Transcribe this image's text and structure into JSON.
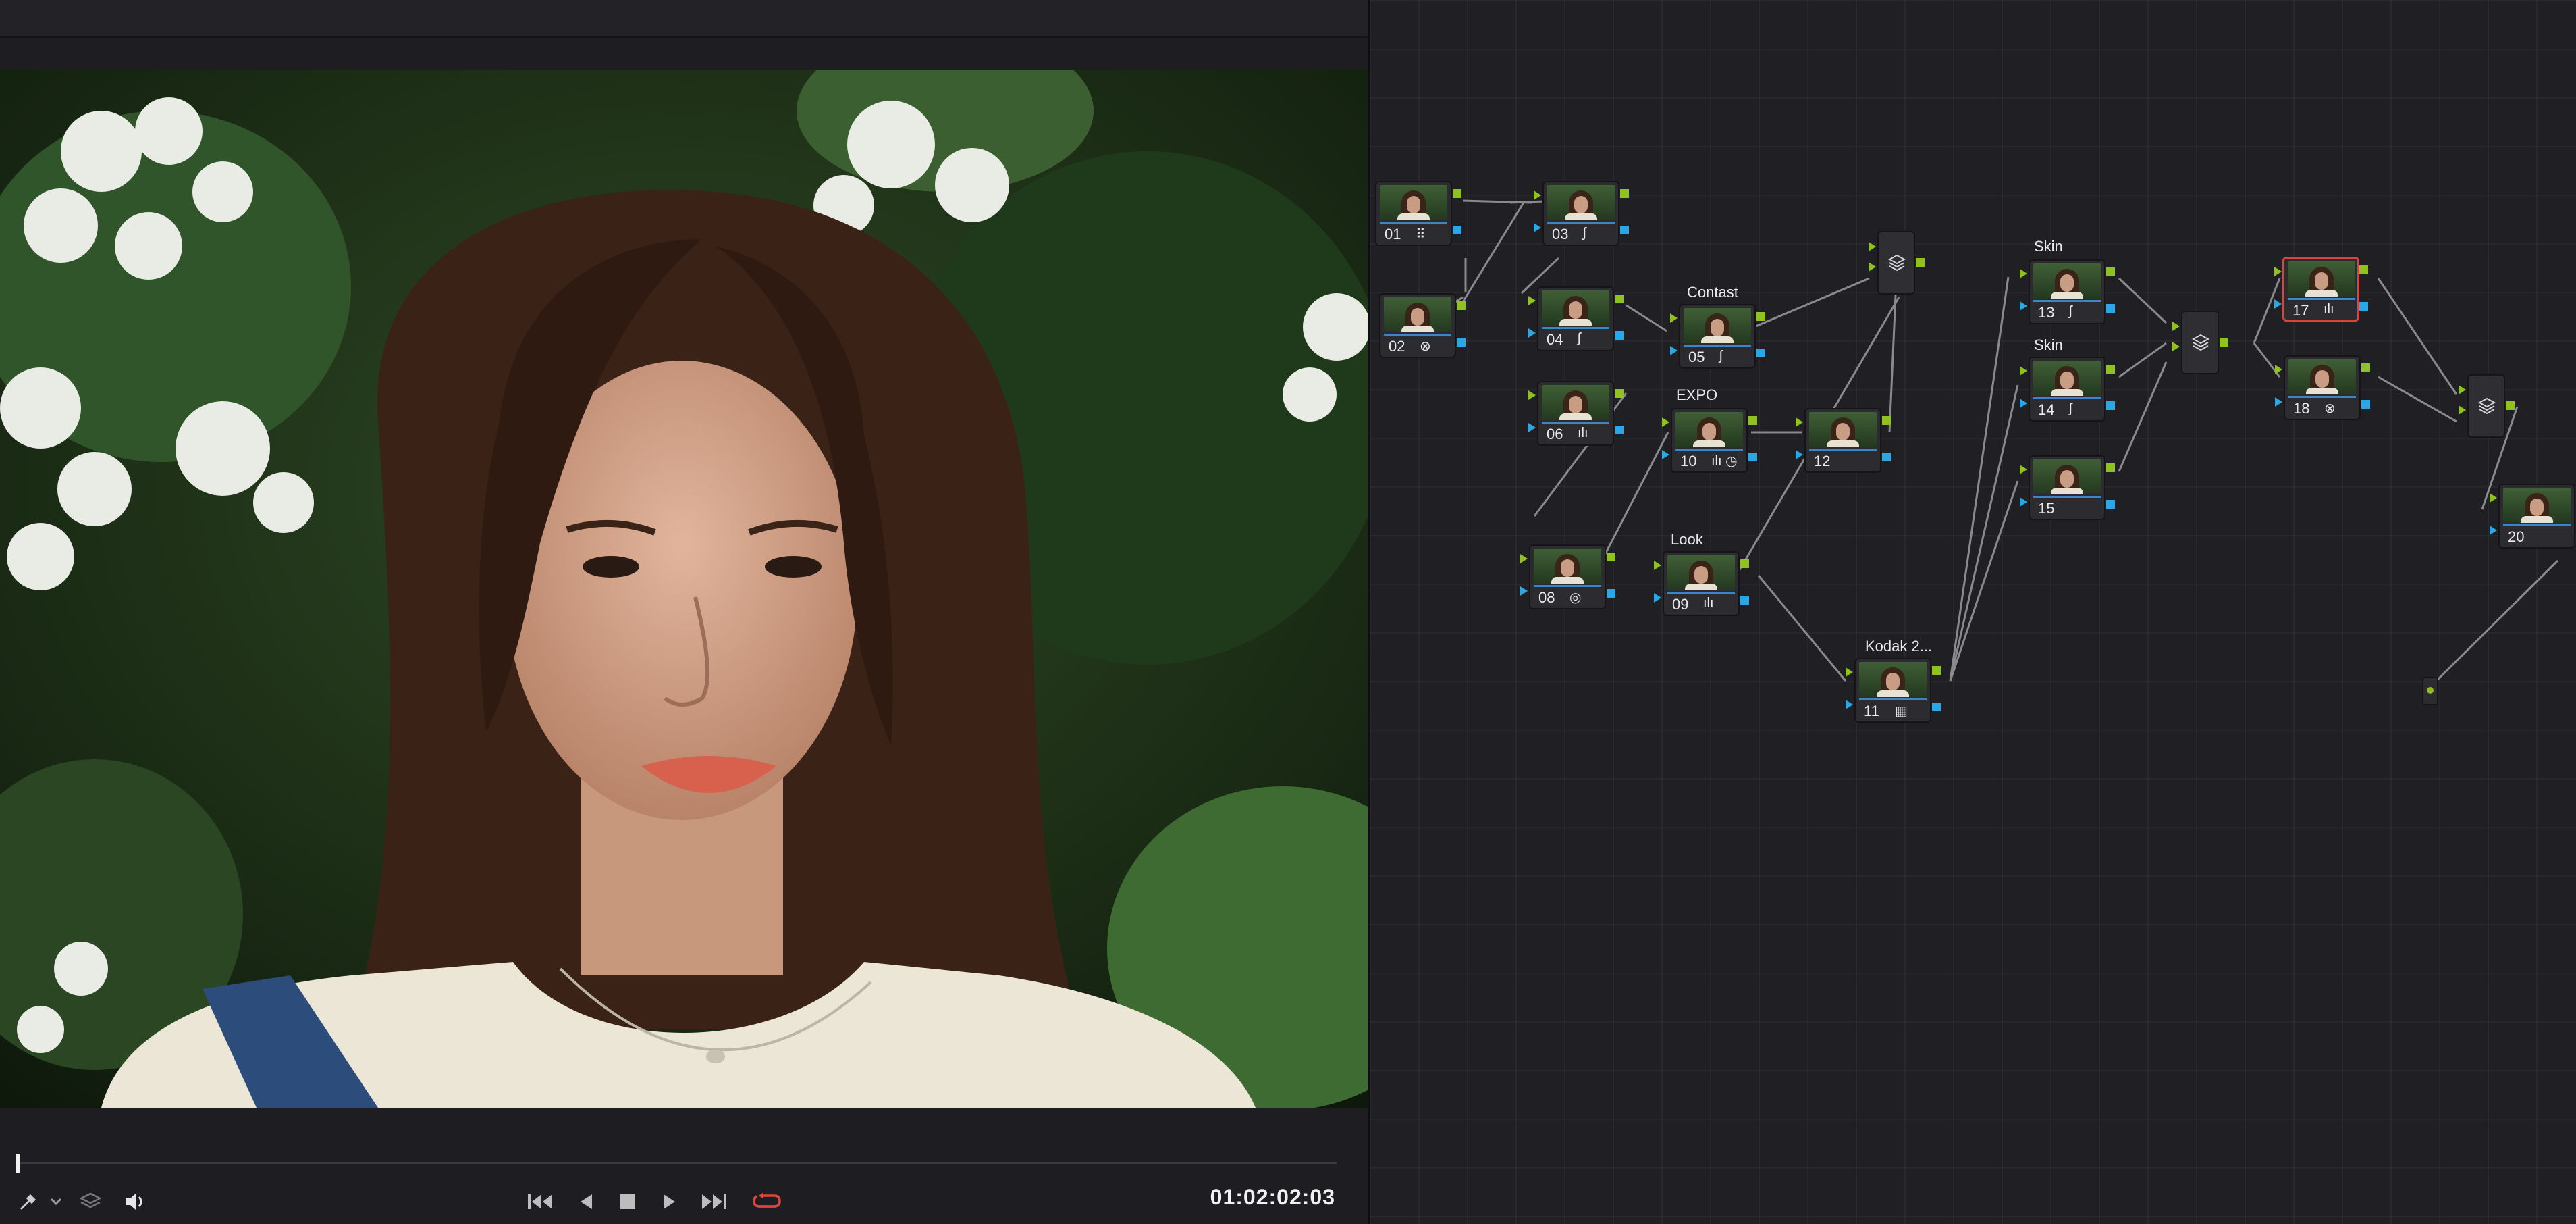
{
  "viewer": {
    "timecode": "01:02:02:03",
    "playhead_fraction": 0.0
  },
  "transport": {
    "icons": [
      "color-picker-icon",
      "chevron-down-icon",
      "layers-icon",
      "volume-icon",
      "skip-to-start-icon",
      "play-reverse-icon",
      "stop-icon",
      "play-icon",
      "skip-to-end-icon",
      "loop-icon"
    ],
    "loop_active_color": "#e0443a"
  },
  "node_graph": {
    "nodes": [
      {
        "id": "01",
        "label": "",
        "tool": "grid-icon"
      },
      {
        "id": "02",
        "label": "",
        "tool": "node-effect-icon"
      },
      {
        "id": "03",
        "label": "",
        "tool": "curve-icon"
      },
      {
        "id": "04",
        "label": "",
        "tool": "curve-icon"
      },
      {
        "id": "05",
        "label": "Contast",
        "tool": "curve-icon"
      },
      {
        "id": "06",
        "label": "",
        "tool": "bars-icon"
      },
      {
        "id": "08",
        "label": "",
        "tool": "wheel-icon"
      },
      {
        "id": "09",
        "label": "Look",
        "tool": "bars-icon"
      },
      {
        "id": "10",
        "label": "EXPO",
        "tool": "bars-clock-icon"
      },
      {
        "id": "11",
        "label": "Kodak 2...",
        "tool": "lut-grid-icon"
      },
      {
        "id": "12",
        "label": "",
        "tool": ""
      },
      {
        "id": "13",
        "label": "Skin",
        "tool": "curve-icon"
      },
      {
        "id": "14",
        "label": "Skin",
        "tool": "curve-icon"
      },
      {
        "id": "15",
        "label": "",
        "tool": ""
      },
      {
        "id": "17",
        "label": "",
        "tool": "bars-icon",
        "selected": true
      },
      {
        "id": "18",
        "label": "",
        "tool": "node-effect-icon"
      },
      {
        "id": "20",
        "label": "",
        "tool": ""
      }
    ],
    "mixers": [
      "layer-mixer-1",
      "layer-mixer-2",
      "layer-mixer-3"
    ],
    "colors": {
      "rgb_port": "#8fc21d",
      "alpha_port": "#2aa8e6",
      "selected_border": "#d8453a"
    }
  }
}
